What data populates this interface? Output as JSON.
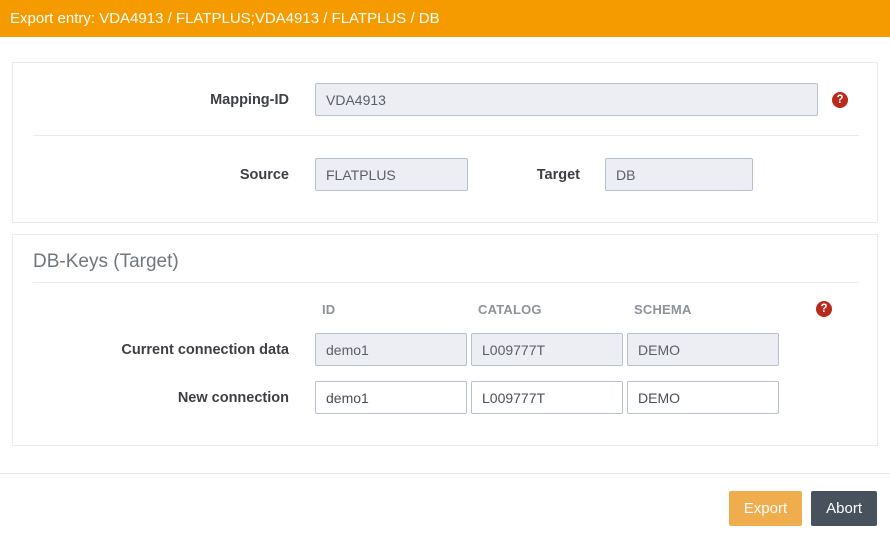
{
  "header": {
    "title": "Export entry: VDA4913 / FLATPLUS;VDA4913 / FLATPLUS / DB"
  },
  "colors": {
    "header_bg": "#F59B00",
    "export_button_bg": "#F0AD4E",
    "abort_button_bg": "#47525D",
    "help_icon_bg": "#B92A1C",
    "disabled_field_bg": "#ECEEF3",
    "field_border": "#B7C0CD"
  },
  "icons": {
    "help_glyph": "?"
  },
  "mapping_panel": {
    "mapping_id": {
      "label": "Mapping-ID",
      "value": "VDA4913"
    },
    "source": {
      "label": "Source",
      "value": "FLATPLUS"
    },
    "target": {
      "label": "Target",
      "value": "DB"
    }
  },
  "db_keys_panel": {
    "title": "DB-Keys (Target)",
    "columns": [
      "ID",
      "CATALOG",
      "SCHEMA"
    ],
    "rows": [
      {
        "label": "Current connection data",
        "editable": false,
        "values": [
          "demo1",
          "L009777T",
          "DEMO"
        ]
      },
      {
        "label": "New connection",
        "editable": true,
        "values": [
          "demo1",
          "L009777T",
          "DEMO"
        ]
      }
    ]
  },
  "footer": {
    "export_label": "Export",
    "abort_label": "Abort"
  }
}
